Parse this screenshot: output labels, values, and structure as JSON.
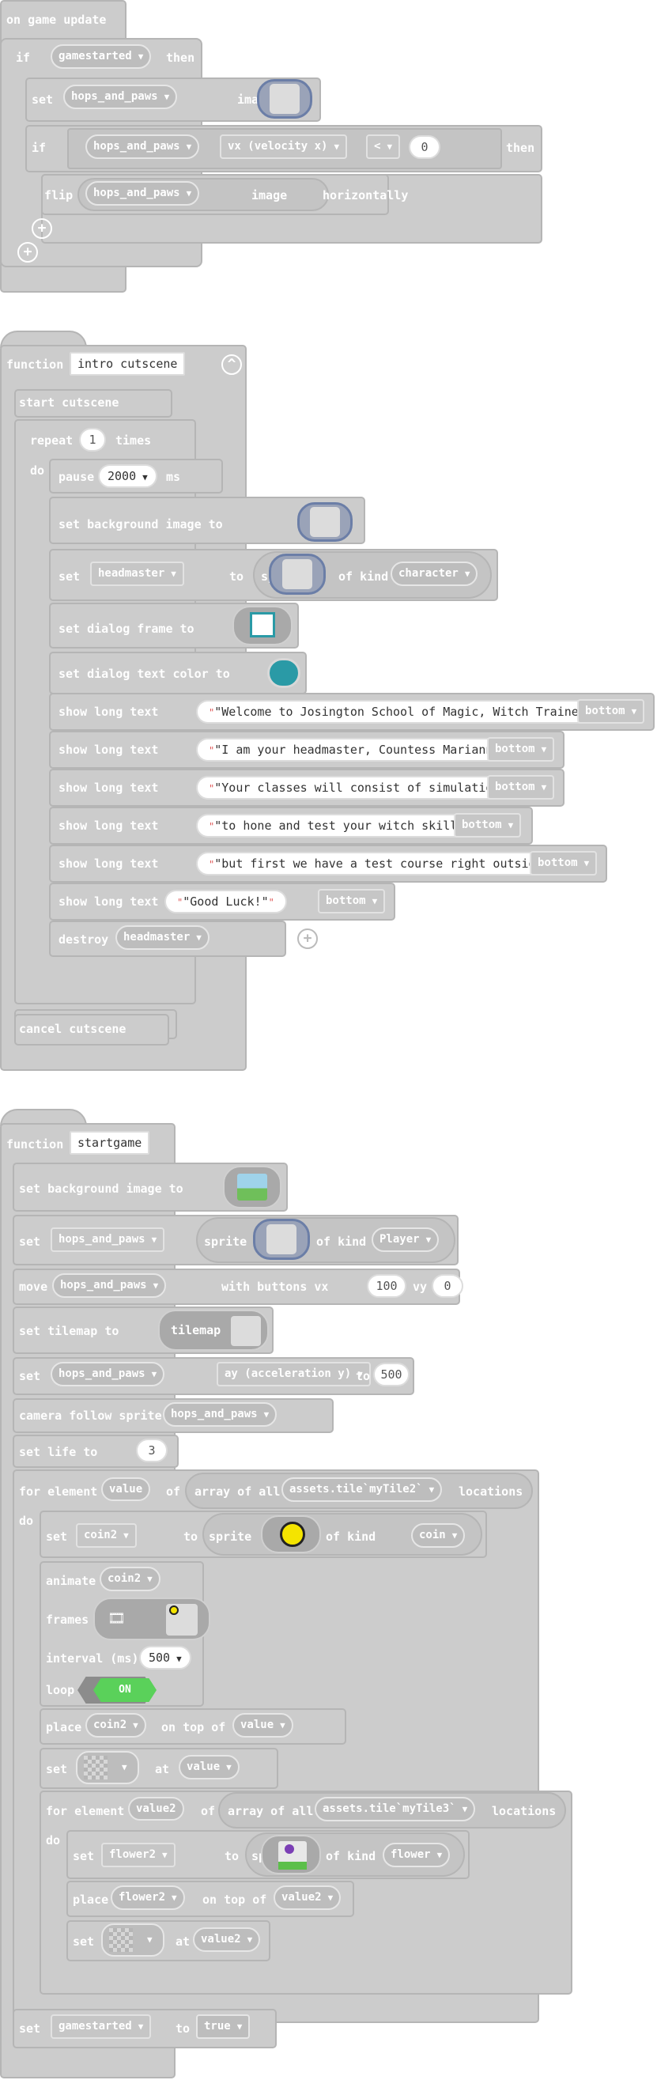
{
  "colors": {
    "block": "#cccccc",
    "block_border": "#b5b5b5",
    "text": "#ffffff",
    "toggle_on": "#5ad15a",
    "dialog_text_color": "#2a9aa6"
  },
  "scripts": {
    "on_game_update": {
      "event": "on game update",
      "if1": {
        "kw_if": "if",
        "cond": "gamestarted",
        "kw_then": "then"
      },
      "set_image": {
        "kw_set": "set",
        "sprite": "hops_and_paws",
        "kw_image_to": "image to"
      },
      "if2": {
        "kw_if": "if",
        "sprite": "hops_and_paws",
        "prop": "vx (velocity x)",
        "op": "<",
        "value": "0",
        "kw_then": "then"
      },
      "flip": {
        "kw_flip": "flip",
        "sprite": "hops_and_paws",
        "kw_image": "image",
        "kw_horizontally": "horizontally"
      }
    },
    "intro_cutscene": {
      "kw_function": "function",
      "name": "intro cutscene",
      "start": "start cutscene",
      "repeat": {
        "kw_repeat": "repeat",
        "count": "1",
        "kw_times": "times",
        "kw_do": "do"
      },
      "pause": {
        "kw_pause": "pause",
        "value": "2000",
        "kw_ms": "ms"
      },
      "set_bg": "set background image to",
      "set_sprite": {
        "kw_set": "set",
        "var": "headmaster",
        "kw_to": "to",
        "kw_sprite": "sprite",
        "kw_of_kind": "of kind",
        "kind": "character"
      },
      "set_dialog_frame": "set dialog frame to",
      "set_dialog_color": "set dialog text color to",
      "show_label": "show long text",
      "texts": [
        {
          "text": "\"Welcome to Josington School of Magic, Witch Trainees!\"",
          "pos": "bottom"
        },
        {
          "text": "\"I am your headmaster, Countess Marianna!\"",
          "pos": "bottom"
        },
        {
          "text": "\"Your classes will consist of simulations\"",
          "pos": "bottom"
        },
        {
          "text": "\"to hone and test your witch skills,\"",
          "pos": "bottom"
        },
        {
          "text": "\"but first we have a test course right outside!\"",
          "pos": "bottom"
        },
        {
          "text": "\"Good Luck!\"",
          "pos": "bottom"
        }
      ],
      "destroy": {
        "kw_destroy": "destroy",
        "sprite": "headmaster"
      },
      "cancel": "cancel cutscene"
    },
    "startgame": {
      "kw_function": "function",
      "name": "startgame",
      "set_bg": "set background image to",
      "set_player": {
        "kw_set": "set",
        "var": "hops_and_paws",
        "kw_to": "to",
        "kw_sprite": "sprite",
        "kw_of_kind": "of kind",
        "kind": "Player"
      },
      "move": {
        "kw_move": "move",
        "sprite": "hops_and_paws",
        "kw_with": "with buttons vx",
        "vx": "100",
        "kw_vy": "vy",
        "vy": "0"
      },
      "tilemap": {
        "label": "set tilemap to",
        "kw_tilemap": "tilemap"
      },
      "set_accel": {
        "kw_set": "set",
        "sprite": "hops_and_paws",
        "prop": "ay (acceleration y)",
        "kw_to": "to",
        "value": "500"
      },
      "camera": {
        "label": "camera follow sprite",
        "sprite": "hops_and_paws"
      },
      "life": {
        "label": "set life to",
        "value": "3"
      },
      "for1": {
        "kw_for": "for element",
        "var": "value",
        "kw_of": "of",
        "kw_array": "array of all",
        "tile": "assets.tile`myTile2`",
        "kw_locations": "locations",
        "kw_do": "do"
      },
      "set_coin": {
        "kw_set": "set",
        "var": "coin2",
        "kw_to": "to",
        "kw_sprite": "sprite",
        "kw_of_kind": "of kind",
        "kind": "coin"
      },
      "animate": {
        "kw_animate": "animate",
        "sprite": "coin2",
        "kw_frames": "frames",
        "kw_interval": "interval (ms)",
        "interval": "500",
        "kw_loop": "loop",
        "loop": "ON"
      },
      "place_coin": {
        "kw_place": "place",
        "sprite": "coin2",
        "kw_on_top": "on top of",
        "loc": "value"
      },
      "set_tile1": {
        "kw_set": "set",
        "kw_at": "at",
        "loc": "value"
      },
      "for2": {
        "kw_for": "for element",
        "var": "value2",
        "kw_of": "of",
        "kw_array": "array of all",
        "tile": "assets.tile`myTile3`",
        "kw_locations": "locations",
        "kw_do": "do"
      },
      "set_flower": {
        "kw_set": "set",
        "var": "flower2",
        "kw_to": "to",
        "kw_sprite": "sprite",
        "kw_of_kind": "of kind",
        "kind": "flower"
      },
      "place_flower": {
        "kw_place": "place",
        "sprite": "flower2",
        "kw_on_top": "on top of",
        "loc": "value2"
      },
      "set_tile2": {
        "kw_set": "set",
        "kw_at": "at",
        "loc": "value2"
      },
      "set_started": {
        "kw_set": "set",
        "var": "gamestarted",
        "kw_to": "to",
        "value": "true"
      }
    }
  }
}
